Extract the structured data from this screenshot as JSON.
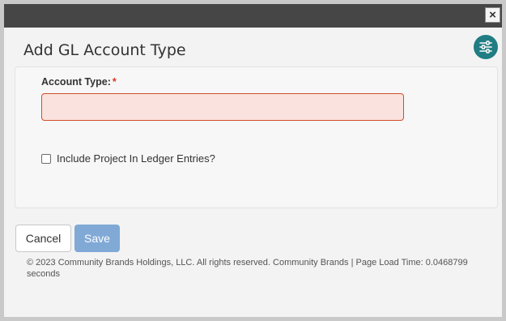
{
  "titlebar": {
    "close_glyph": "×",
    "close_icon": "close-icon"
  },
  "header": {
    "title": "Add GL Account Type",
    "settings_icon": "sliders-icon",
    "settings_color": "#1f7d83"
  },
  "form": {
    "account_type": {
      "label": "Account Type:",
      "required_mark": "*",
      "value": "",
      "placeholder": ""
    },
    "include_project": {
      "label": "Include Project In Ledger Entries?",
      "checked": false
    }
  },
  "actions": {
    "cancel_label": "Cancel",
    "save_label": "Save"
  },
  "footer": {
    "text": "© 2023 Community Brands Holdings, LLC. All rights reserved. Community Brands | Page Load Time: 0.0468799 seconds"
  },
  "colors": {
    "titlebar": "#464646",
    "input_error_bg": "#fae3de",
    "input_error_border": "#d04e2b",
    "save_button": "#80a9d6",
    "required": "#d9391c"
  }
}
